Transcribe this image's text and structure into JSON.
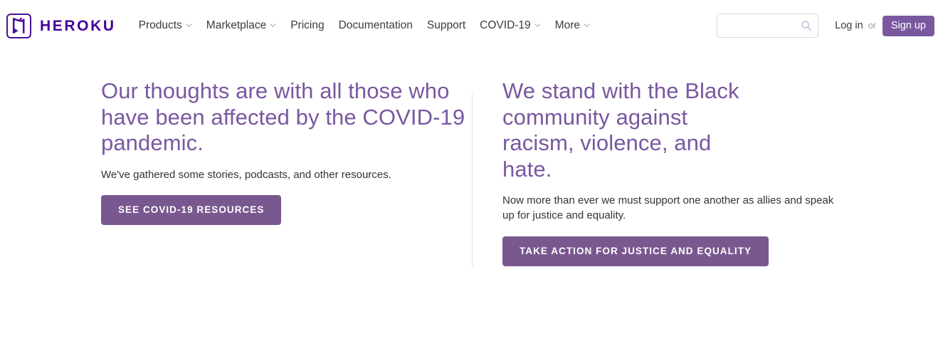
{
  "header": {
    "brand": {
      "logo_icon": "heroku-logo-icon",
      "wordmark": "HEROKU"
    },
    "nav_items": [
      {
        "label": "Products",
        "has_dropdown": true,
        "icon": "chevron-down-icon"
      },
      {
        "label": "Marketplace",
        "has_dropdown": true,
        "icon": "chevron-down-icon"
      },
      {
        "label": "Pricing",
        "has_dropdown": false,
        "icon": ""
      },
      {
        "label": "Documentation",
        "has_dropdown": false,
        "icon": ""
      },
      {
        "label": "Support",
        "has_dropdown": false,
        "icon": ""
      },
      {
        "label": "COVID-19",
        "has_dropdown": true,
        "icon": "chevron-down-icon"
      },
      {
        "label": "More",
        "has_dropdown": true,
        "icon": "chevron-down-icon"
      }
    ],
    "search": {
      "value": "",
      "placeholder": "",
      "icon": "search-icon"
    },
    "login_label": "Log in",
    "or_label": "or",
    "signup_label": "Sign up"
  },
  "banners": [
    {
      "headline": "Our thoughts are with all those who have been affected by the COVID-19 pandemic.",
      "subtext": "We've gathered some stories, podcasts, and other resources.",
      "cta_label": "See COVID-19 Resources"
    },
    {
      "headline": "We stand with the Black community against racism, violence, and hate.",
      "subtext": "Now more than ever we must support one another as allies and speak up for justice and equality.",
      "cta_label": "Take Action for Justice and Equality"
    }
  ],
  "colors": {
    "brand_deep_purple": "#430098",
    "accent_purple": "#79589f",
    "button_purple": "#79588f",
    "headline_purple": "#79589f",
    "body_text": "#333333",
    "nav_text": "#3c3c3c",
    "muted_text": "#9b9b9b",
    "divider": "#e2e2e2",
    "input_border": "#d9d9d9",
    "background": "#ffffff"
  }
}
